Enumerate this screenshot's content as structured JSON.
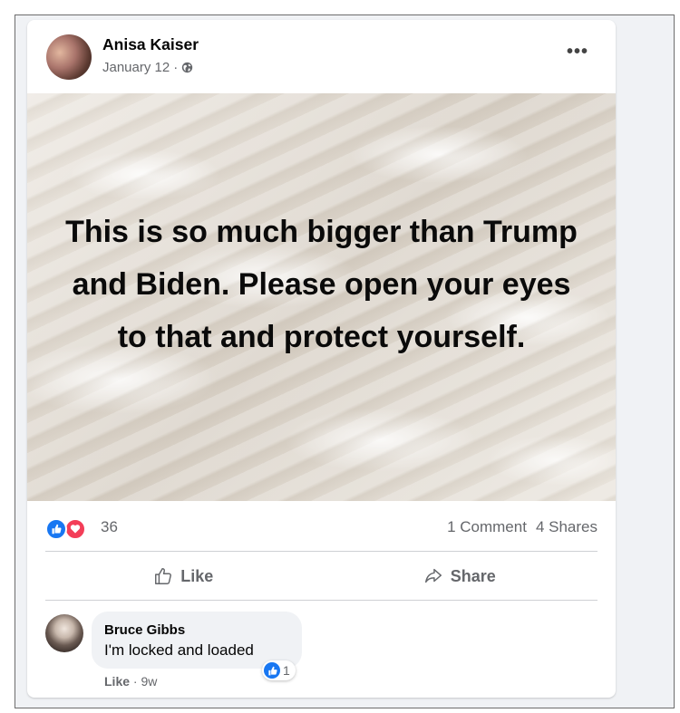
{
  "post": {
    "author": "Anisa Kaiser",
    "date": "January 12",
    "separator": "·",
    "privacy_icon": "globe-icon",
    "more_label": "•••",
    "image_text": "This is so much bigger than Trump and Biden. Please open your eyes to that and protect yourself."
  },
  "reactions": {
    "icons": [
      "like-reaction-icon",
      "love-reaction-icon"
    ],
    "count": "36",
    "comments": "1 Comment",
    "shares": "4 Shares"
  },
  "actions": {
    "like_label": "Like",
    "share_label": "Share"
  },
  "comment": {
    "author": "Bruce Gibbs",
    "text": "I'm locked and loaded",
    "reaction_count": "1",
    "like_label": "Like",
    "separator": "·",
    "time": "9w"
  },
  "colors": {
    "accent": "#1877f2",
    "love": "#f33e58",
    "secondary_text": "#65676b",
    "background": "#f0f2f5"
  }
}
